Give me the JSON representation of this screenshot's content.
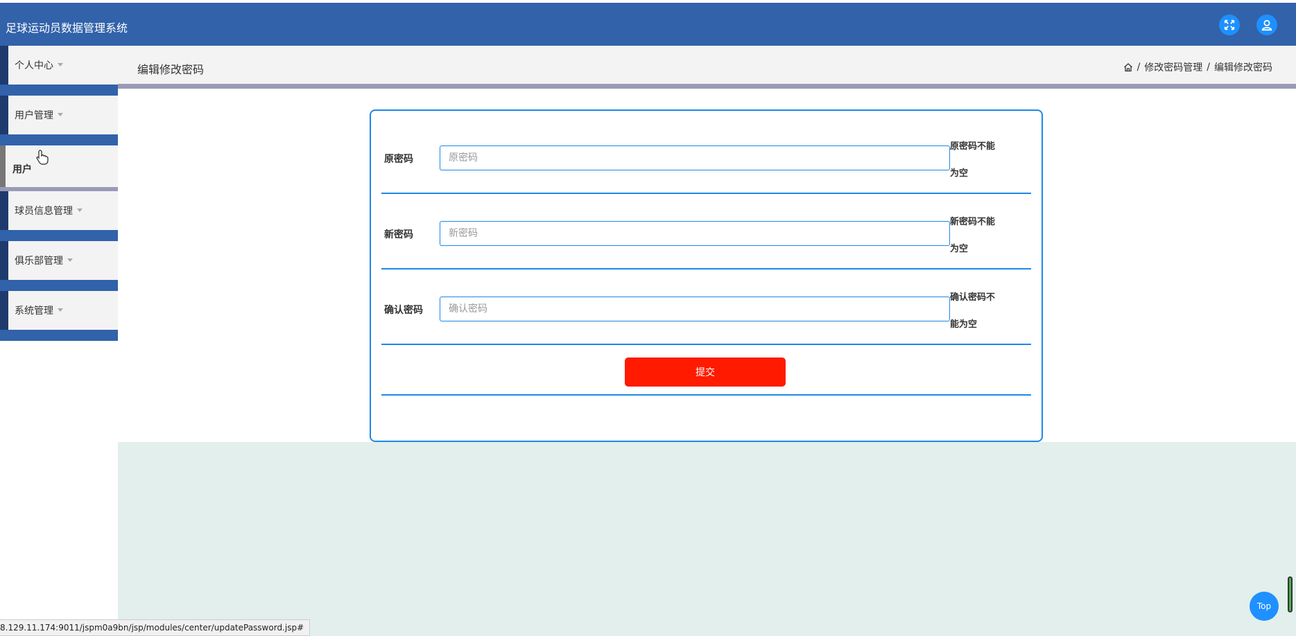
{
  "app": {
    "title": "足球运动员数据管理系统"
  },
  "header_icons": {
    "expand": "expand-arrows-icon",
    "user": "user-icon"
  },
  "sidebar": {
    "items": [
      {
        "label": "个人中心",
        "has_caret": true
      },
      {
        "label": "用户管理",
        "has_caret": true
      },
      {
        "label": "用户",
        "submenu": true
      },
      {
        "label": "球员信息管理",
        "has_caret": true
      },
      {
        "label": "俱乐部管理",
        "has_caret": true
      },
      {
        "label": "系统管理",
        "has_caret": true
      }
    ]
  },
  "page": {
    "title": "编辑修改密码",
    "breadcrumb": {
      "sep1": "/",
      "crumb1": "修改密码管理",
      "sep2": "/",
      "crumb2": "编辑修改密码"
    }
  },
  "form": {
    "fields": [
      {
        "label": "原密码",
        "placeholder": "原密码",
        "value": "",
        "error": "原密码不能为空"
      },
      {
        "label": "新密码",
        "placeholder": "新密码",
        "value": "",
        "error": "新密码不能为空"
      },
      {
        "label": "确认密码",
        "placeholder": "确认密码",
        "value": "",
        "error": "确认密码不能为空"
      }
    ],
    "submit_label": "提交"
  },
  "status_bar": {
    "url": "8.129.11.174:9011/jspm0a9bn/jsp/modules/center/updatePassword.jsp#"
  },
  "back_to_top": {
    "label": "Top"
  },
  "colors": {
    "header": "#3162aa",
    "accent": "#1e88e5",
    "submit": "#ff1a00",
    "content_bg": "#e2efec"
  }
}
